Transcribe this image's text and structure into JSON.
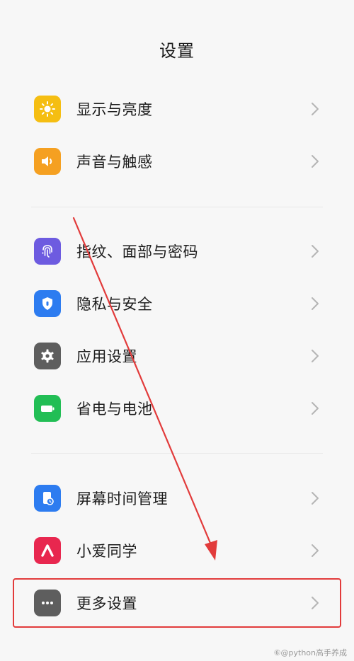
{
  "header": {
    "title": "设置"
  },
  "groups": [
    {
      "items": [
        {
          "label": "显示与亮度",
          "icon": "brightness-icon",
          "color": "#F5BE12"
        },
        {
          "label": "声音与触感",
          "icon": "speaker-icon",
          "color": "#F5A021"
        }
      ]
    },
    {
      "items": [
        {
          "label": "指纹、面部与密码",
          "icon": "fingerprint-icon",
          "color": "#6D5BE0"
        },
        {
          "label": "隐私与安全",
          "icon": "shield-icon",
          "color": "#2D7CF0"
        },
        {
          "label": "应用设置",
          "icon": "gear-icon",
          "color": "#5E5E5E"
        },
        {
          "label": "省电与电池",
          "icon": "battery-icon",
          "color": "#22BE55"
        }
      ]
    },
    {
      "items": [
        {
          "label": "屏幕时间管理",
          "icon": "screen-time-icon",
          "color": "#2D7CF0"
        },
        {
          "label": "小爱同学",
          "icon": "xiaoai-icon",
          "color": "#E8274F"
        },
        {
          "label": "更多设置",
          "icon": "more-dots-icon",
          "color": "#5E5E5E"
        }
      ]
    }
  ],
  "annotation": {
    "color": "#E23B3B",
    "highlighted_item": "更多设置"
  },
  "watermark": "⑥@python高手养成"
}
